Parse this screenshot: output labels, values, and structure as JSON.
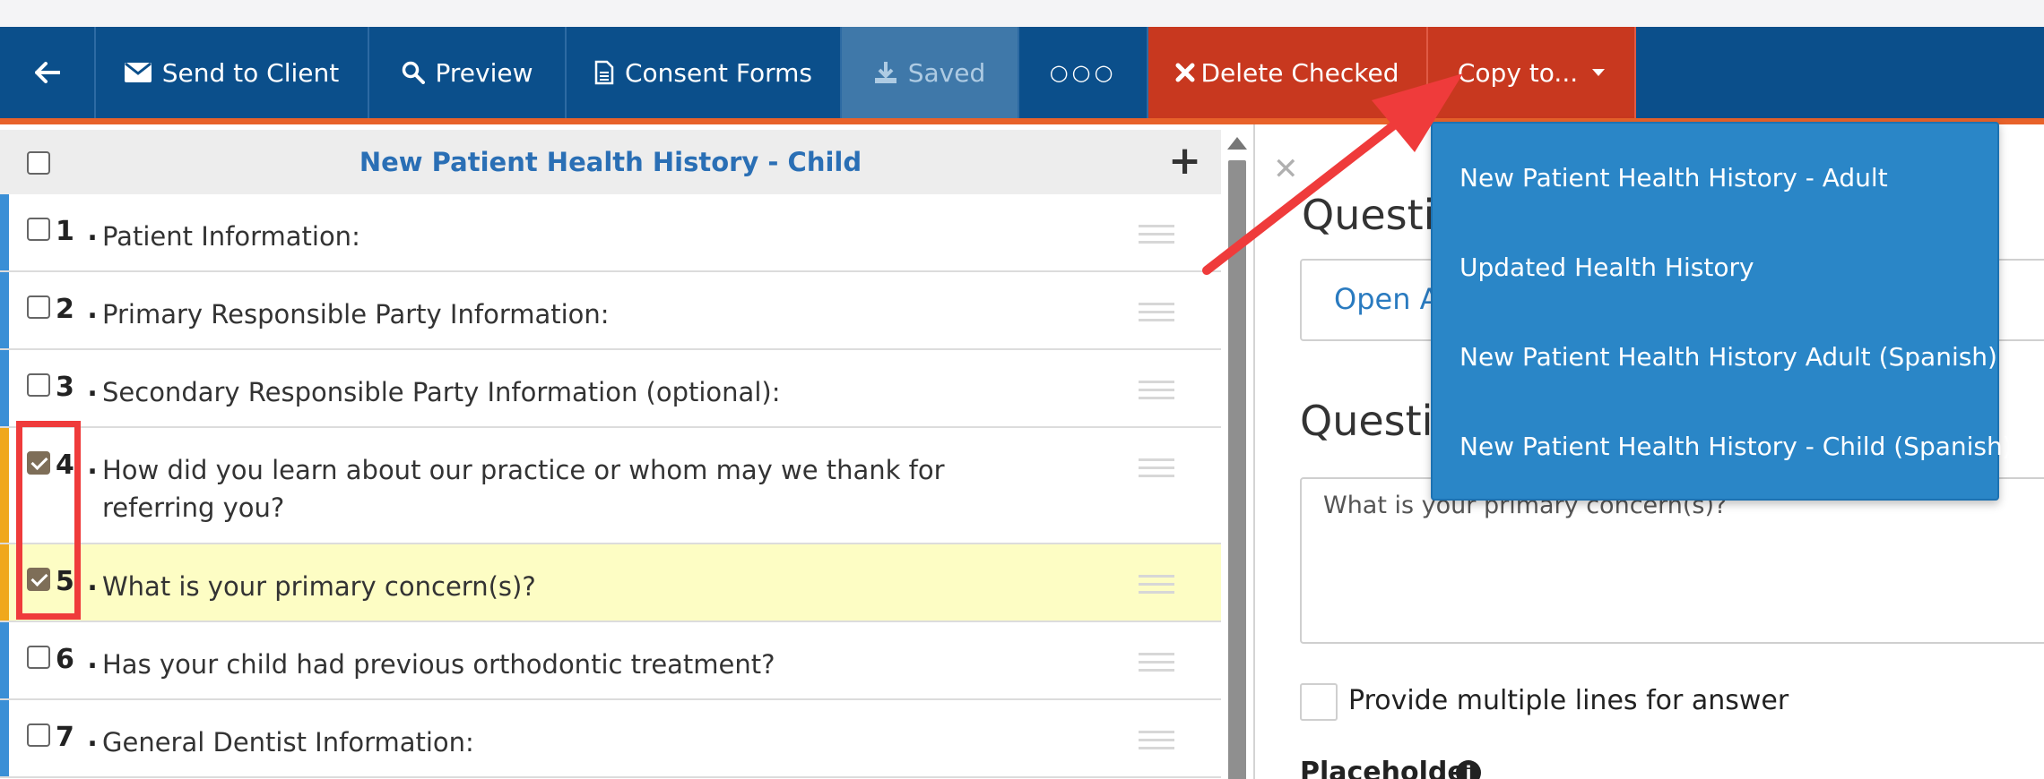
{
  "toolbar": {
    "back_icon": "arrow-left-icon",
    "send_to_client": "Send to Client",
    "preview": "Preview",
    "consent_forms": "Consent Forms",
    "saved": "Saved",
    "more": "○○○",
    "delete_checked": "Delete Checked",
    "copy_to": "Copy to...",
    "colors": {
      "bar": "#0b4f8b",
      "danger": "#c8381f",
      "accent_line": "#e8622a"
    }
  },
  "form": {
    "title": "New Patient Health History - Child",
    "questions": [
      {
        "number": "1 .",
        "text": "Patient Information:",
        "checked": false
      },
      {
        "number": "2 .",
        "text": "Primary Responsible Party Information:",
        "checked": false
      },
      {
        "number": "3 .",
        "text": "Secondary Responsible Party Information (optional):",
        "checked": false
      },
      {
        "number": "4 .",
        "text": "How did you learn about our practice or whom may we thank for referring you?",
        "checked": true
      },
      {
        "number": "5 .",
        "text": "What is your primary concern(s)?",
        "checked": true
      },
      {
        "number": "6 .",
        "text": "Has your child had previous orthodontic treatment?",
        "checked": false
      },
      {
        "number": "7 .",
        "text": "General Dentist Information:",
        "checked": false
      }
    ]
  },
  "editor": {
    "question_type_label": "Questic",
    "question_type_value": "Open A",
    "question_label": "Questic",
    "question_text": "What is your primary concern(s)?",
    "multiline_label": "Provide multiple lines for answer",
    "placeholder_label": "Placeholder"
  },
  "copy_menu": {
    "items": [
      "New Patient Health History - Adult",
      "Updated Health History",
      "New Patient Health History Adult (Spanish)",
      "New Patient Health History - Child (Spanish)"
    ]
  }
}
